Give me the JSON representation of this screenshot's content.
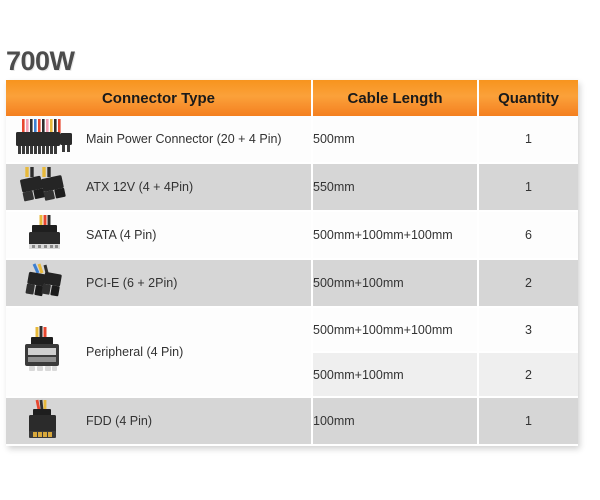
{
  "title": "700W",
  "table": {
    "columns": [
      {
        "key": "connector",
        "label": "Connector Type"
      },
      {
        "key": "length",
        "label": "Cable Length"
      },
      {
        "key": "quantity",
        "label": "Quantity"
      }
    ],
    "rows": [
      {
        "connector": "Main Power Connector (20 + 4 Pin)",
        "icon": "atx-24pin-connector-icon",
        "entries": [
          {
            "length": "500mm",
            "quantity": "1"
          }
        ]
      },
      {
        "connector": "ATX 12V (4 + 4Pin)",
        "icon": "atx-12v-8pin-connector-icon",
        "entries": [
          {
            "length": "550mm",
            "quantity": "1"
          }
        ]
      },
      {
        "connector": "SATA (4 Pin)",
        "icon": "sata-power-connector-icon",
        "entries": [
          {
            "length": "500mm+100mm+100mm",
            "quantity": "6"
          }
        ]
      },
      {
        "connector": "PCI-E (6 + 2Pin)",
        "icon": "pcie-8pin-connector-icon",
        "entries": [
          {
            "length": "500mm+100mm",
            "quantity": "2"
          }
        ]
      },
      {
        "connector": "Peripheral (4 Pin)",
        "icon": "molex-peripheral-connector-icon",
        "entries": [
          {
            "length": "500mm+100mm+100mm",
            "quantity": "3"
          },
          {
            "length": "500mm+100mm",
            "quantity": "2"
          }
        ]
      },
      {
        "connector": "FDD (4 Pin)",
        "icon": "fdd-floppy-connector-icon",
        "entries": [
          {
            "length": "100mm",
            "quantity": "1"
          }
        ]
      }
    ]
  },
  "colors": {
    "header_orange": "#f7941e",
    "header_orange_dark": "#f47f20",
    "row_gray": "#d6d6d6",
    "row_light": "#efefef",
    "row_white": "#fdfdfd",
    "title_text": "#4c4c4c",
    "body_text": "#333333"
  }
}
